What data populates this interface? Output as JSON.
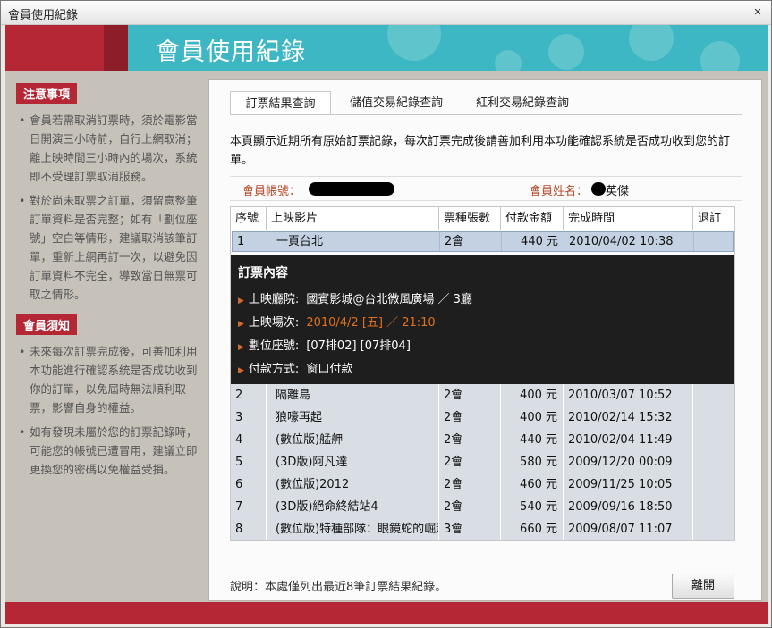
{
  "window": {
    "title": "會員使用紀錄",
    "close_glyph": "✕"
  },
  "header": {
    "title": "會員使用紀錄"
  },
  "sidebar": {
    "section1": {
      "title": "注意事項",
      "items": [
        "會員若需取消訂票時，須於電影當日開演三小時前，自行上網取消；離上映時間三小時內的場次，系統即不受理訂票取消服務。",
        "對於尚未取票之訂單，須留意整筆訂單資料是否完整；如有「劃位座號」空白等情形，建議取消該筆訂單，重新上網再訂一次，以避免因訂單資料不完全，導致當日無票可取之情形。"
      ]
    },
    "section2": {
      "title": "會員須知",
      "items": [
        "未來每次訂票完成後，可善加利用本功能進行確認系統是否成功收到你的訂單，以免屆時無法順利取票，影響自身的權益。",
        "如有發現未屬於您的訂票記錄時，可能您的帳號已遭冒用，建議立即更換您的密碼以免權益受損。"
      ]
    }
  },
  "tabs": [
    {
      "label": "訂票結果查詢",
      "active": true
    },
    {
      "label": "儲值交易紀錄查詢",
      "active": false
    },
    {
      "label": "紅利交易紀錄查詢",
      "active": false
    }
  ],
  "description": "本頁顯示近期所有原始訂票記錄，每次訂票完成後請善加利用本功能確認系統是否成功收到您的訂單。",
  "member": {
    "account_label": "會員帳號：",
    "name_label": "會員姓名：",
    "name_value": "英傑"
  },
  "table": {
    "headers": [
      "序號",
      "上映影片",
      "票種張數",
      "付款金額",
      "完成時間",
      "退訂"
    ],
    "selected_row": {
      "no": "1",
      "movie": "一頁台北",
      "tickets": "2會",
      "amount": "440 元",
      "time": "2010/04/02 10:38",
      "refund": ""
    },
    "detail": {
      "title": "訂票內容",
      "rows": [
        {
          "label": "上映廳院:",
          "value": "國賓影城@台北微風廣場 ／ 3廳",
          "highlight": false
        },
        {
          "label": "上映場次:",
          "value": "2010/4/2 [五] ／ 21:10",
          "highlight": true
        },
        {
          "label": "劃位座號:",
          "value": "[07排02] [07排04]",
          "highlight": false
        },
        {
          "label": "付款方式:",
          "value": "窗口付款",
          "highlight": false
        }
      ]
    },
    "rows": [
      {
        "no": "2",
        "movie": "隔離島",
        "tickets": "2會",
        "amount": "400 元",
        "time": "2010/03/07 10:52",
        "refund": ""
      },
      {
        "no": "3",
        "movie": "狼嚎再起",
        "tickets": "2會",
        "amount": "400 元",
        "time": "2010/02/14 15:32",
        "refund": ""
      },
      {
        "no": "4",
        "movie": "(數位版)艋舺",
        "tickets": "2會",
        "amount": "440 元",
        "time": "2010/02/04 11:49",
        "refund": ""
      },
      {
        "no": "5",
        "movie": "(3D版)阿凡達",
        "tickets": "2會",
        "amount": "580 元",
        "time": "2009/12/20 00:09",
        "refund": ""
      },
      {
        "no": "6",
        "movie": "(數位版)2012",
        "tickets": "2會",
        "amount": "460 元",
        "time": "2009/11/25 10:05",
        "refund": ""
      },
      {
        "no": "7",
        "movie": "(3D版)絕命終結站4",
        "tickets": "2會",
        "amount": "540 元",
        "time": "2009/09/16 18:50",
        "refund": ""
      },
      {
        "no": "8",
        "movie": "(數位版)特種部隊：眼鏡蛇的崛起",
        "tickets": "3會",
        "amount": "660 元",
        "time": "2009/08/07 11:07",
        "refund": ""
      }
    ]
  },
  "note": "說明：本處僅列出最近8筆訂票結果紀錄。",
  "close_button": "離開",
  "colors": {
    "brand_red": "#b52735",
    "header_teal": "#3db7c3",
    "highlight_orange": "#e0711f"
  }
}
